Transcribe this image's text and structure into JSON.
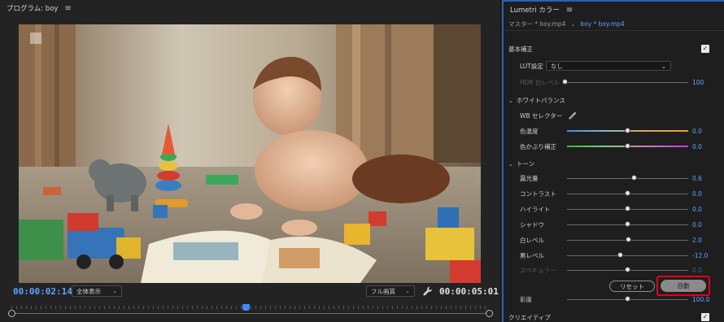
{
  "program": {
    "title": "プログラム: boy",
    "menu_icon": "hamburger-menu-icon",
    "timecode_current": "00:00:02:14",
    "timecode_duration": "00:00:05:01",
    "zoom_label": "全体表示",
    "quality_label": "フル画質",
    "settings_icon": "wrench-icon",
    "playhead_fraction": 0.49
  },
  "lumetri": {
    "title": "Lumetri カラー",
    "menu_icon": "hamburger-menu-icon",
    "tab_master": "マスター * boy.mp4",
    "tab_clip": "boy * boy.mp4",
    "basic": {
      "title": "基本補正",
      "enabled": true,
      "lut_label": "LUT設定",
      "lut_value": "なし",
      "hdr_label": "HDR 白レベル",
      "hdr_value": "100"
    },
    "white_balance": {
      "title": "ホワイトバランス",
      "wb_selector_label": "WB セレクター",
      "temperature_label": "色温度",
      "temperature_value": "0.0",
      "tint_label": "色かぶり補正",
      "tint_value": "0.0"
    },
    "tone": {
      "title": "トーン",
      "sliders": [
        {
          "label": "露光量",
          "value": "0.6",
          "fraction": 0.56,
          "dim": false
        },
        {
          "label": "コントラスト",
          "value": "0.0",
          "fraction": 0.5,
          "dim": false
        },
        {
          "label": "ハイライト",
          "value": "0.0",
          "fraction": 0.5,
          "dim": false
        },
        {
          "label": "シャドウ",
          "value": "0.0",
          "fraction": 0.5,
          "dim": false
        },
        {
          "label": "白レベル",
          "value": "2.0",
          "fraction": 0.51,
          "dim": false
        },
        {
          "label": "黒レベル",
          "value": "-12.0",
          "fraction": 0.44,
          "dim": false
        },
        {
          "label": "スペキュラー",
          "value": "0.0",
          "fraction": 0.5,
          "dim": true
        }
      ],
      "reset_label": "リセット",
      "auto_label": "自動",
      "auto_highlight_color": "#e3001b",
      "saturation_label": "彩度",
      "saturation_value": "100.0"
    },
    "creative": {
      "title": "クリエイティブ",
      "enabled": true
    },
    "accent_color": "#5ea3ff"
  }
}
